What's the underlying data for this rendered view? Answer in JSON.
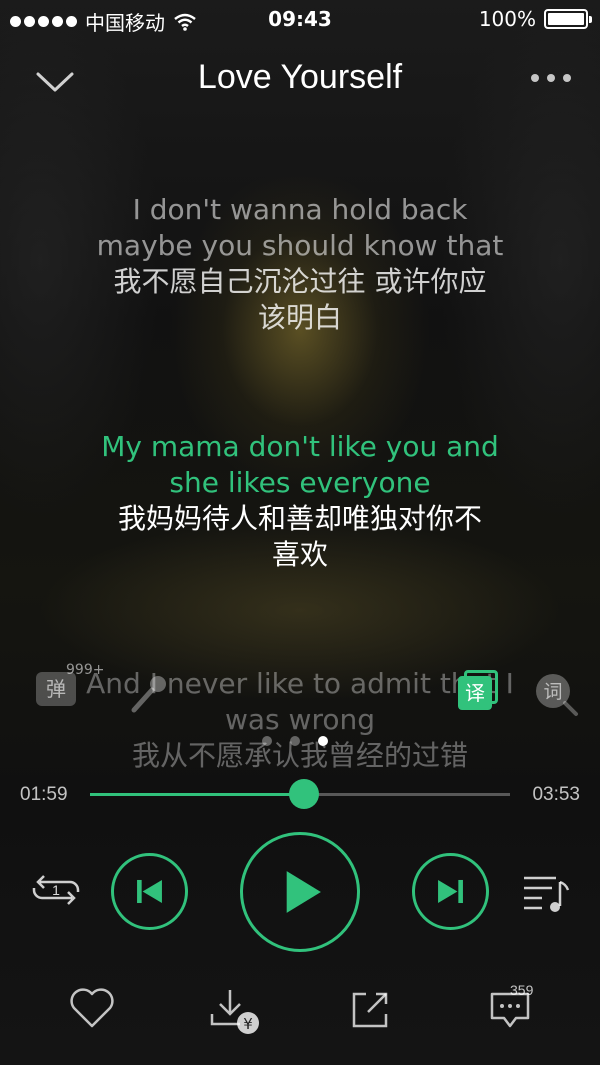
{
  "status_bar": {
    "carrier": "中国移动",
    "time": "09:43",
    "battery": "100%"
  },
  "header": {
    "title": "Love Yourself"
  },
  "lyrics": {
    "previous": {
      "en1": "I don't wanna hold back",
      "en2": "maybe you should know that",
      "zh1": "我不愿自己沉沦过往 或许你应",
      "zh2": "该明白"
    },
    "current": {
      "en1": "My mama don't like you and",
      "en2": "she likes everyone",
      "zh1": "我妈妈待人和善却唯独对你不",
      "zh2": "喜欢"
    },
    "next": {
      "en1": "And I never like to admit that I",
      "en2": "was wrong",
      "zh1": "我从不愿承认我曾经的过错"
    }
  },
  "overlay": {
    "danmu_label": "弹",
    "danmu_count": "999+",
    "translate_label": "译",
    "pages": 3,
    "active_page": 3
  },
  "player": {
    "elapsed": "01:59",
    "duration": "03:53",
    "progress": 0.51,
    "repeat_label": "1"
  },
  "bottom": {
    "comment_count": "359"
  },
  "colors": {
    "accent": "#31c27c"
  },
  "icons": [
    "chevron-down-icon",
    "more-icon",
    "danmu-icon",
    "mic-icon",
    "translate-icon",
    "lyric-search-icon",
    "repeat-one-icon",
    "previous-icon",
    "play-icon",
    "next-icon",
    "playlist-icon",
    "heart-icon",
    "download-icon",
    "share-icon",
    "comment-icon"
  ]
}
